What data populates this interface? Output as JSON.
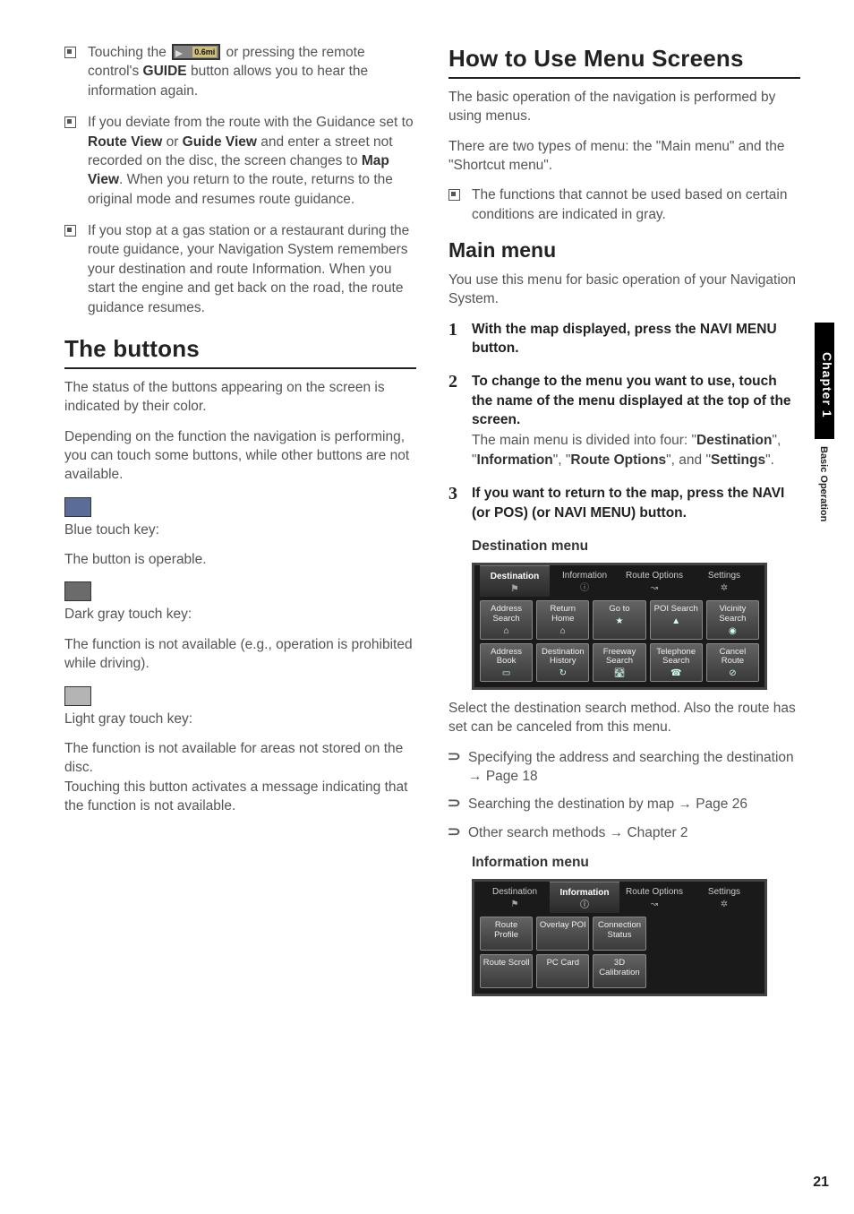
{
  "sidetab": {
    "chapter": "Chapter 1",
    "section": "Basic Operation"
  },
  "page_number": "21",
  "left": {
    "bullets": [
      {
        "pre": "Touching the ",
        "icon_text": "0.6mi",
        "mid": " or pressing the remote control's ",
        "b1": "GUIDE",
        "post": " button allows you to hear the information again."
      },
      {
        "text_a": "If you deviate from the route with the Guidance set to ",
        "b1": "Route View",
        "mid1": " or ",
        "b2": "Guide View",
        "mid2": " and enter a street not recorded on the disc, the screen changes to ",
        "b3": "Map View",
        "post": ". When you return to the route, returns to the original mode and resumes route guidance."
      },
      {
        "full": "If you stop at a gas station or a restaurant during the route guidance, your Navigation System remembers your destination and route Information. When you start the engine and get back on the road, the route guidance resumes."
      }
    ],
    "h_buttons": "The buttons",
    "buttons_intro1": "The status of the buttons appearing on the screen is indicated by their color.",
    "buttons_intro2": "Depending on the function the navigation is performing, you can touch some buttons, while other buttons are not available.",
    "keys": [
      {
        "title": "Blue touch key:",
        "desc": "The button is operable."
      },
      {
        "title": "Dark gray touch key:",
        "desc": "The function is not available (e.g., operation is prohibited while driving)."
      },
      {
        "title": "Light gray touch key:",
        "desc": "The function is not available for areas not stored on the disc.\nTouching this button activates a message indicating that the function is not available."
      }
    ]
  },
  "right": {
    "h_use": "How to Use Menu Screens",
    "use_p1": "The basic operation of the navigation is performed by using menus.",
    "use_p2": "There are two types of menu: the \"Main menu\" and the \"Shortcut menu\".",
    "use_bullet": "The functions that cannot be used based on certain conditions are indicated in gray.",
    "h_main": "Main menu",
    "main_p": "You use this menu for basic operation of your Navigation System.",
    "steps": [
      {
        "n": "1",
        "lead_a": "With the map displayed, press the ",
        "b1": "NAVI MENU",
        "lead_b": " button."
      },
      {
        "n": "2",
        "lead": "To change to the menu you want to use, touch the name of the menu displayed at the top of the screen.",
        "sub_a": "The main menu is divided into four: \"",
        "s1": "Destination",
        "m1": "\", \"",
        "s2": "Information",
        "m2": "\", \"",
        "s3": "Route Options",
        "m3": "\", and \"",
        "s4": "Settings",
        "m4": "\"."
      },
      {
        "n": "3",
        "lead_a": "If you want to return to the map, press the ",
        "b1": "NAVI (or POS) (or NAVI MENU)",
        "lead_b": " button."
      }
    ],
    "dest_title": "Destination menu",
    "dest_tabs": [
      "Destination",
      "Information",
      "Route Options",
      "Settings"
    ],
    "dest_cells": [
      [
        "Address Search",
        "Return Home",
        "Go to",
        "POI Search",
        "Vicinity Search"
      ],
      [
        "Address Book",
        "Destination History",
        "Freeway Search",
        "Telephone Search",
        "Cancel Route"
      ]
    ],
    "dest_p": "Select the destination search method. Also the route has set can be canceled from this menu.",
    "dest_links": [
      {
        "t": "Specifying the address and searching the destination ",
        "ref": "Page 18"
      },
      {
        "t": "Searching the destination by map ",
        "ref": "Page 26"
      },
      {
        "t": "Other search methods ",
        "ref": "Chapter 2"
      }
    ],
    "info_title": "Information menu",
    "info_tabs": [
      "Destination",
      "Information",
      "Route Options",
      "Settings"
    ],
    "info_cells": [
      [
        "Route Profile",
        "Overlay POI",
        "Connection Status",
        "",
        ""
      ],
      [
        "Route Scroll",
        "PC Card",
        "3D Calibration",
        "",
        ""
      ]
    ]
  }
}
